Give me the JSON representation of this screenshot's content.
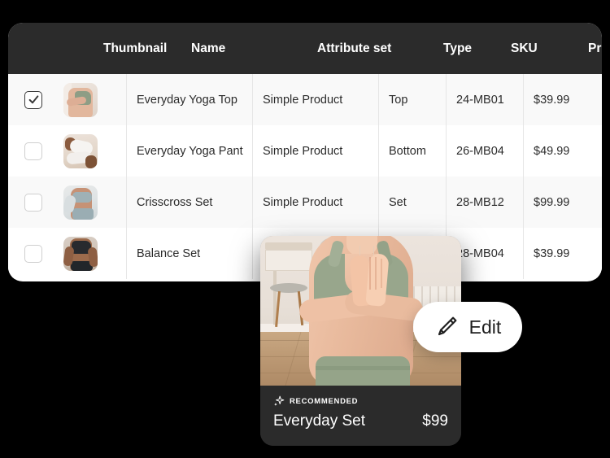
{
  "table": {
    "columns": [
      {
        "key": "thumbnail",
        "label": "Thumbnail"
      },
      {
        "key": "name",
        "label": "Name"
      },
      {
        "key": "attribute_set",
        "label": "Attribute set"
      },
      {
        "key": "type",
        "label": "Type"
      },
      {
        "key": "sku",
        "label": "SKU"
      },
      {
        "key": "price",
        "label": "Price"
      }
    ],
    "rows": [
      {
        "selected": true,
        "name": "Everyday Yoga Top",
        "attribute_set": "Simple Product",
        "type": "Top",
        "sku": "24-MB01",
        "price": "$39.99"
      },
      {
        "selected": false,
        "name": "Everyday Yoga Pant",
        "attribute_set": "Simple Product",
        "type": "Bottom",
        "sku": "26-MB04",
        "price": "$49.99"
      },
      {
        "selected": false,
        "name": "Crisscross Set",
        "attribute_set": "Simple Product",
        "type": "Set",
        "sku": "28-MB12",
        "price": "$99.99"
      },
      {
        "selected": false,
        "name": "Balance Set",
        "attribute_set": "",
        "type": "",
        "sku": "28-MB04",
        "price": "$39.99"
      }
    ]
  },
  "product_card": {
    "badge_label": "RECOMMENDED",
    "badge_icon": "sparkle-icon",
    "title": "Everyday Set",
    "price": "$99"
  },
  "edit_button": {
    "label": "Edit",
    "icon": "pencil-icon"
  },
  "colors": {
    "header_bg": "#2b2b2b",
    "card_bg": "#2b2b2b",
    "page_bg": "#000000",
    "row_alt_bg": "#f9f9f9",
    "row_bg": "#ffffff",
    "text_dark": "#2b2b2b",
    "text_light": "#ffffff",
    "divider": "#e6e6e6"
  }
}
